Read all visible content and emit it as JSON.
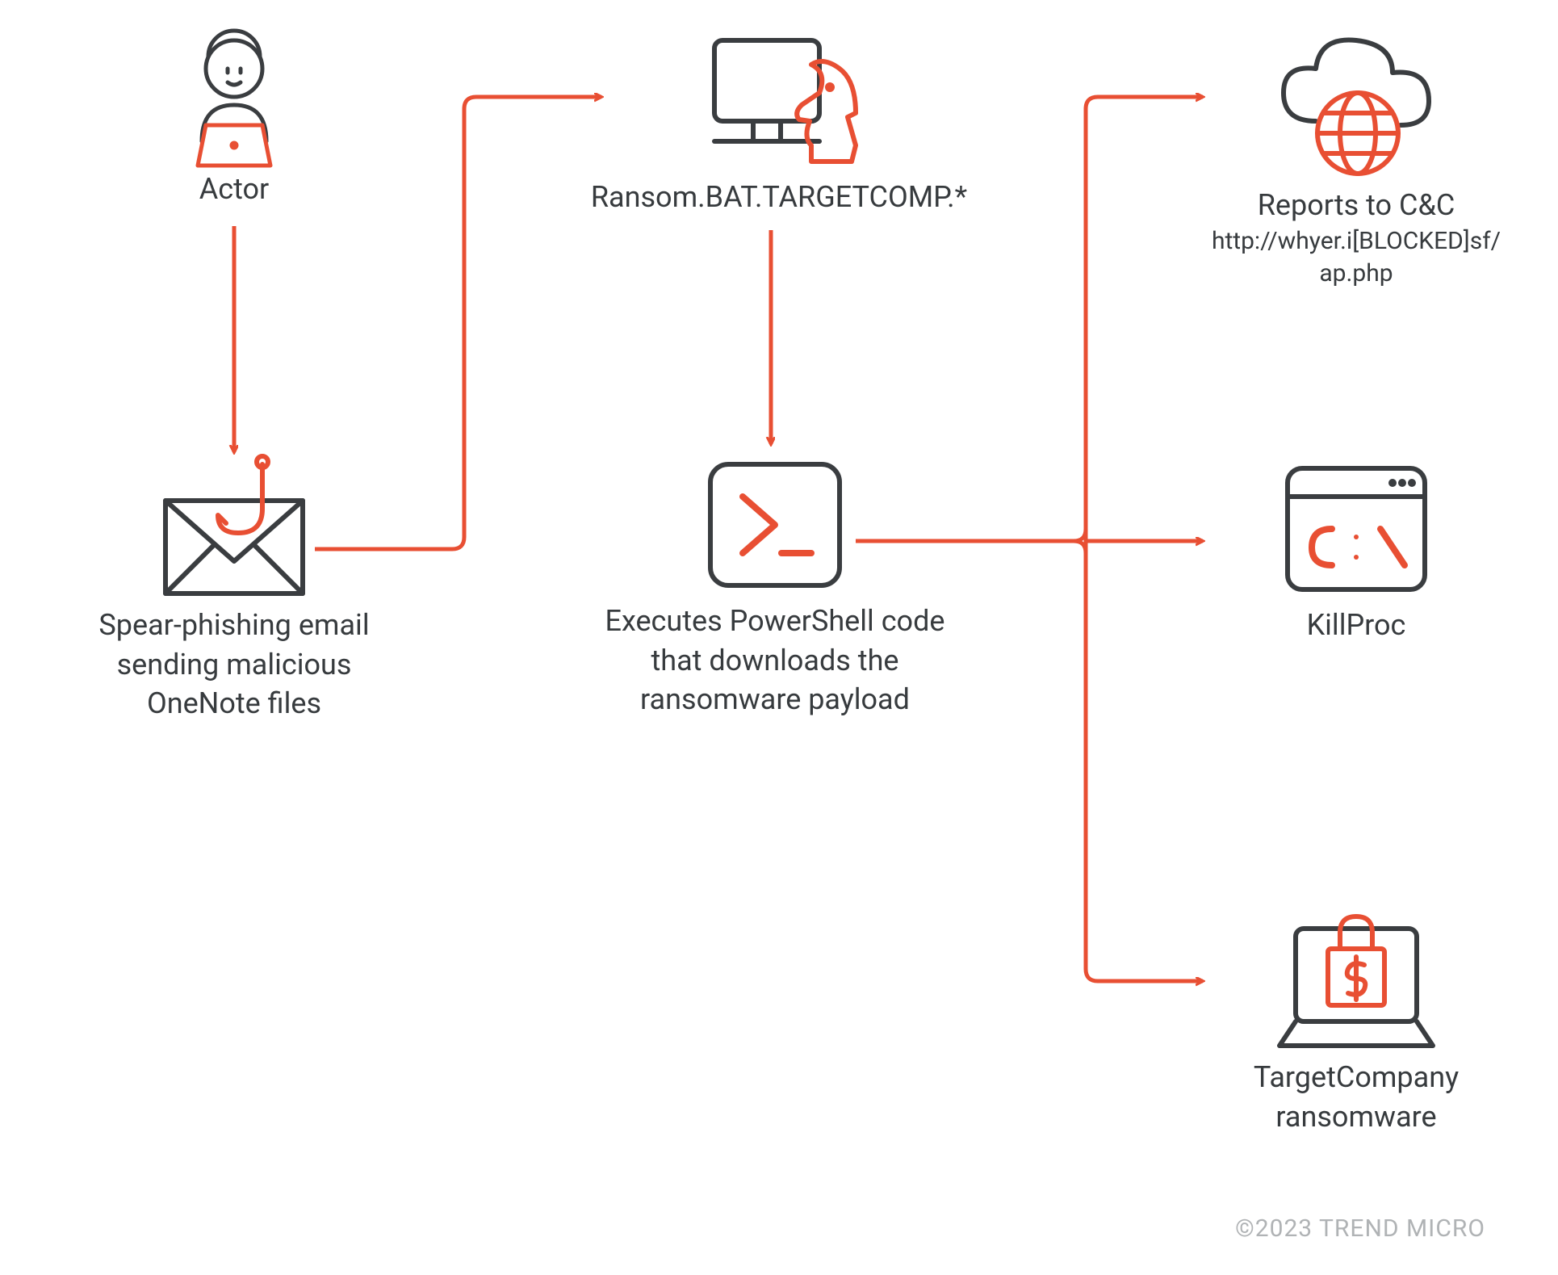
{
  "diagram": {
    "colors": {
      "accent": "#e84f33",
      "line": "#3a3d40",
      "muted": "#b0b3b5"
    },
    "nodes": {
      "actor": {
        "label": "Actor"
      },
      "phishing": {
        "label": "Spear-phishing email sending malicious OneNote files"
      },
      "targetcomp_bat": {
        "label": "Ransom.BAT.TARGETCOMP.*"
      },
      "powershell": {
        "label": "Executes PowerShell code that downloads the ransomware payload"
      },
      "c2": {
        "label": "Reports to C&C",
        "subLine1": "http://whyer.i[BLOCKED]sf/",
        "subLine2": "ap.php"
      },
      "killproc": {
        "label": "KillProc"
      },
      "ransomware": {
        "label": "TargetCompany ransomware"
      }
    },
    "arrows": [
      {
        "from": "actor",
        "to": "phishing"
      },
      {
        "from": "phishing",
        "to": "targetcomp_bat"
      },
      {
        "from": "targetcomp_bat",
        "to": "powershell"
      },
      {
        "from": "powershell",
        "to": "c2"
      },
      {
        "from": "powershell",
        "to": "killproc"
      },
      {
        "from": "powershell",
        "to": "ransomware"
      }
    ],
    "copyright": "©2023 TREND MICRO"
  }
}
